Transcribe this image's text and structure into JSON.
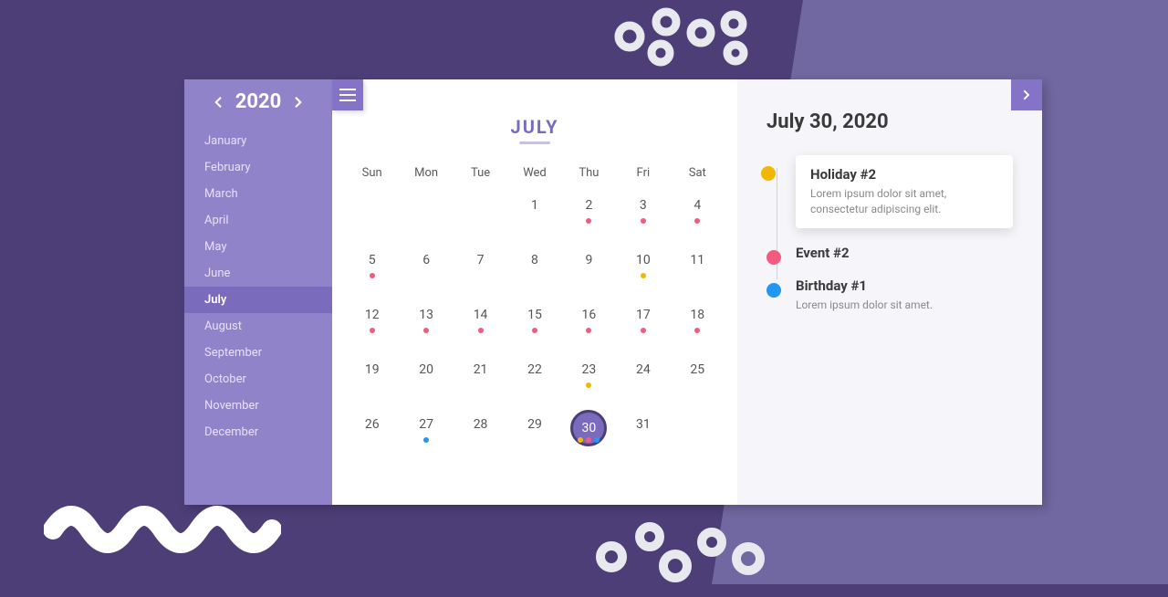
{
  "sidebar": {
    "year": "2020",
    "months": [
      "January",
      "February",
      "March",
      "April",
      "May",
      "June",
      "July",
      "August",
      "September",
      "October",
      "November",
      "December"
    ],
    "selected_index": 6
  },
  "calendar": {
    "title": "JULY",
    "dow": [
      "Sun",
      "Mon",
      "Tue",
      "Wed",
      "Thu",
      "Fri",
      "Sat"
    ],
    "selected_day": 30,
    "weeks": [
      [
        null,
        null,
        null,
        {
          "n": 1
        },
        {
          "n": 2,
          "dots": [
            "pink"
          ]
        },
        {
          "n": 3,
          "dots": [
            "pink"
          ]
        },
        {
          "n": 4,
          "dots": [
            "pink"
          ]
        }
      ],
      [
        {
          "n": 5,
          "dots": [
            "pink"
          ]
        },
        {
          "n": 6
        },
        {
          "n": 7
        },
        {
          "n": 8
        },
        {
          "n": 9
        },
        {
          "n": 10,
          "dots": [
            "yellow"
          ]
        },
        {
          "n": 11
        }
      ],
      [
        {
          "n": 12,
          "dots": [
            "pink"
          ]
        },
        {
          "n": 13,
          "dots": [
            "pink"
          ]
        },
        {
          "n": 14,
          "dots": [
            "pink"
          ]
        },
        {
          "n": 15,
          "dots": [
            "pink"
          ]
        },
        {
          "n": 16,
          "dots": [
            "pink"
          ]
        },
        {
          "n": 17,
          "dots": [
            "pink"
          ]
        },
        {
          "n": 18,
          "dots": [
            "pink"
          ]
        }
      ],
      [
        {
          "n": 19
        },
        {
          "n": 20
        },
        {
          "n": 21
        },
        {
          "n": 22
        },
        {
          "n": 23,
          "dots": [
            "yellow"
          ]
        },
        {
          "n": 24
        },
        {
          "n": 25
        }
      ],
      [
        {
          "n": 26
        },
        {
          "n": 27,
          "dots": [
            "blue"
          ]
        },
        {
          "n": 28
        },
        {
          "n": 29
        },
        {
          "n": 30,
          "dots": [
            "yellow",
            "pink",
            "blue"
          ]
        },
        {
          "n": 31
        },
        null
      ]
    ]
  },
  "details": {
    "date_label": "July 30, 2020",
    "events": [
      {
        "color": "yellow",
        "title": "Holiday #2",
        "desc": "Lorem ipsum dolor sit amet, consectetur adipiscing elit.",
        "card": true
      },
      {
        "color": "pink",
        "title": "Event #2",
        "desc": "",
        "card": false
      },
      {
        "color": "blue",
        "title": "Birthday #1",
        "desc": "Lorem ipsum dolor sit amet.",
        "card": false
      }
    ]
  }
}
